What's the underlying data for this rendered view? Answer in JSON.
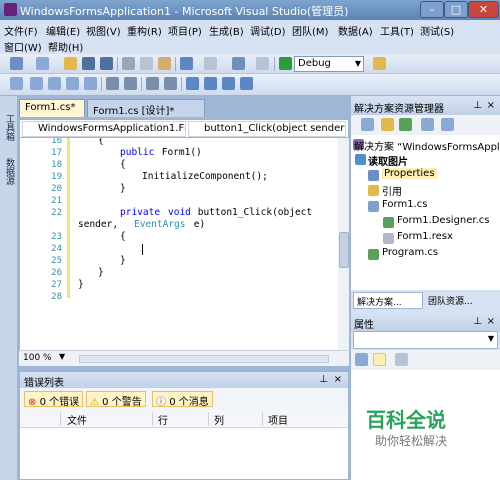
{
  "window": {
    "title": "WindowsFormsApplication1 - Microsoft Visual Studio(管理员)",
    "min": "–",
    "max": "□",
    "close": "✕"
  },
  "menubar": {
    "row1": [
      "文件(F)",
      "编辑(E)",
      "视图(V)",
      "重构(R)",
      "项目(P)",
      "生成(B)",
      "调试(D)",
      "团队(M)",
      "数据(A)",
      "工具(T)",
      "测试(S)"
    ],
    "row2": [
      "窗口(W)",
      "帮助(H)"
    ]
  },
  "toolbar": {
    "config": "Debug"
  },
  "side_tabs": [
    "工具箱",
    "数据源"
  ],
  "doc_tabs": [
    "Form1.cs*",
    "Form1.cs [设计]*"
  ],
  "nav": {
    "class": "WindowsFormsApplication1.Fc",
    "member": "button1_Click(object sender, E"
  },
  "code": {
    "line_numbers": [
      "16",
      "17",
      "18",
      "19",
      "20",
      "21",
      "22",
      "",
      "23",
      "24",
      "25",
      "26",
      "27",
      "28"
    ],
    "l16": "{",
    "l17_kw": "public",
    "l17_rest": " Form1()",
    "l18": "{",
    "l19": "InitializeComponent();",
    "l20": "}",
    "l22_kw1": "private",
    "l22_kw2": "void",
    "l22_rest": " button1_Click(object",
    "l22b_a": "sender, ",
    "l22b_type": "EventArgs",
    "l22b_b": " e)",
    "l23": "{",
    "l25": "}",
    "l26": "}",
    "l27": "}"
  },
  "zoom": "100 %",
  "errors": {
    "title": "错误列表",
    "filter_errors": "0 个错误",
    "filter_warnings": "0 个警告",
    "filter_messages": "0 个消息",
    "columns": [
      "文件",
      "行",
      "列",
      "项目"
    ]
  },
  "solution_explorer": {
    "title": "解决方案资源管理器",
    "items": [
      "解决方案 “WindowsFormsAppli",
      "读取图片",
      "Properties",
      "引用",
      "Form1.cs",
      "Form1.Designer.cs",
      "Form1.resx",
      "Program.cs"
    ],
    "tabs": [
      "解决方案...",
      "团队资源..."
    ]
  },
  "properties": {
    "title": "属性"
  },
  "watermark": {
    "line1": "百科全说",
    "line2": "助你轻松解决"
  },
  "colors": {
    "title_bar": "#5b83b5",
    "background": "#9fb6d6",
    "keyword": "#0000ff",
    "type": "#2b91af",
    "line_number": "#2b91af",
    "watermark": "#27a35a"
  }
}
